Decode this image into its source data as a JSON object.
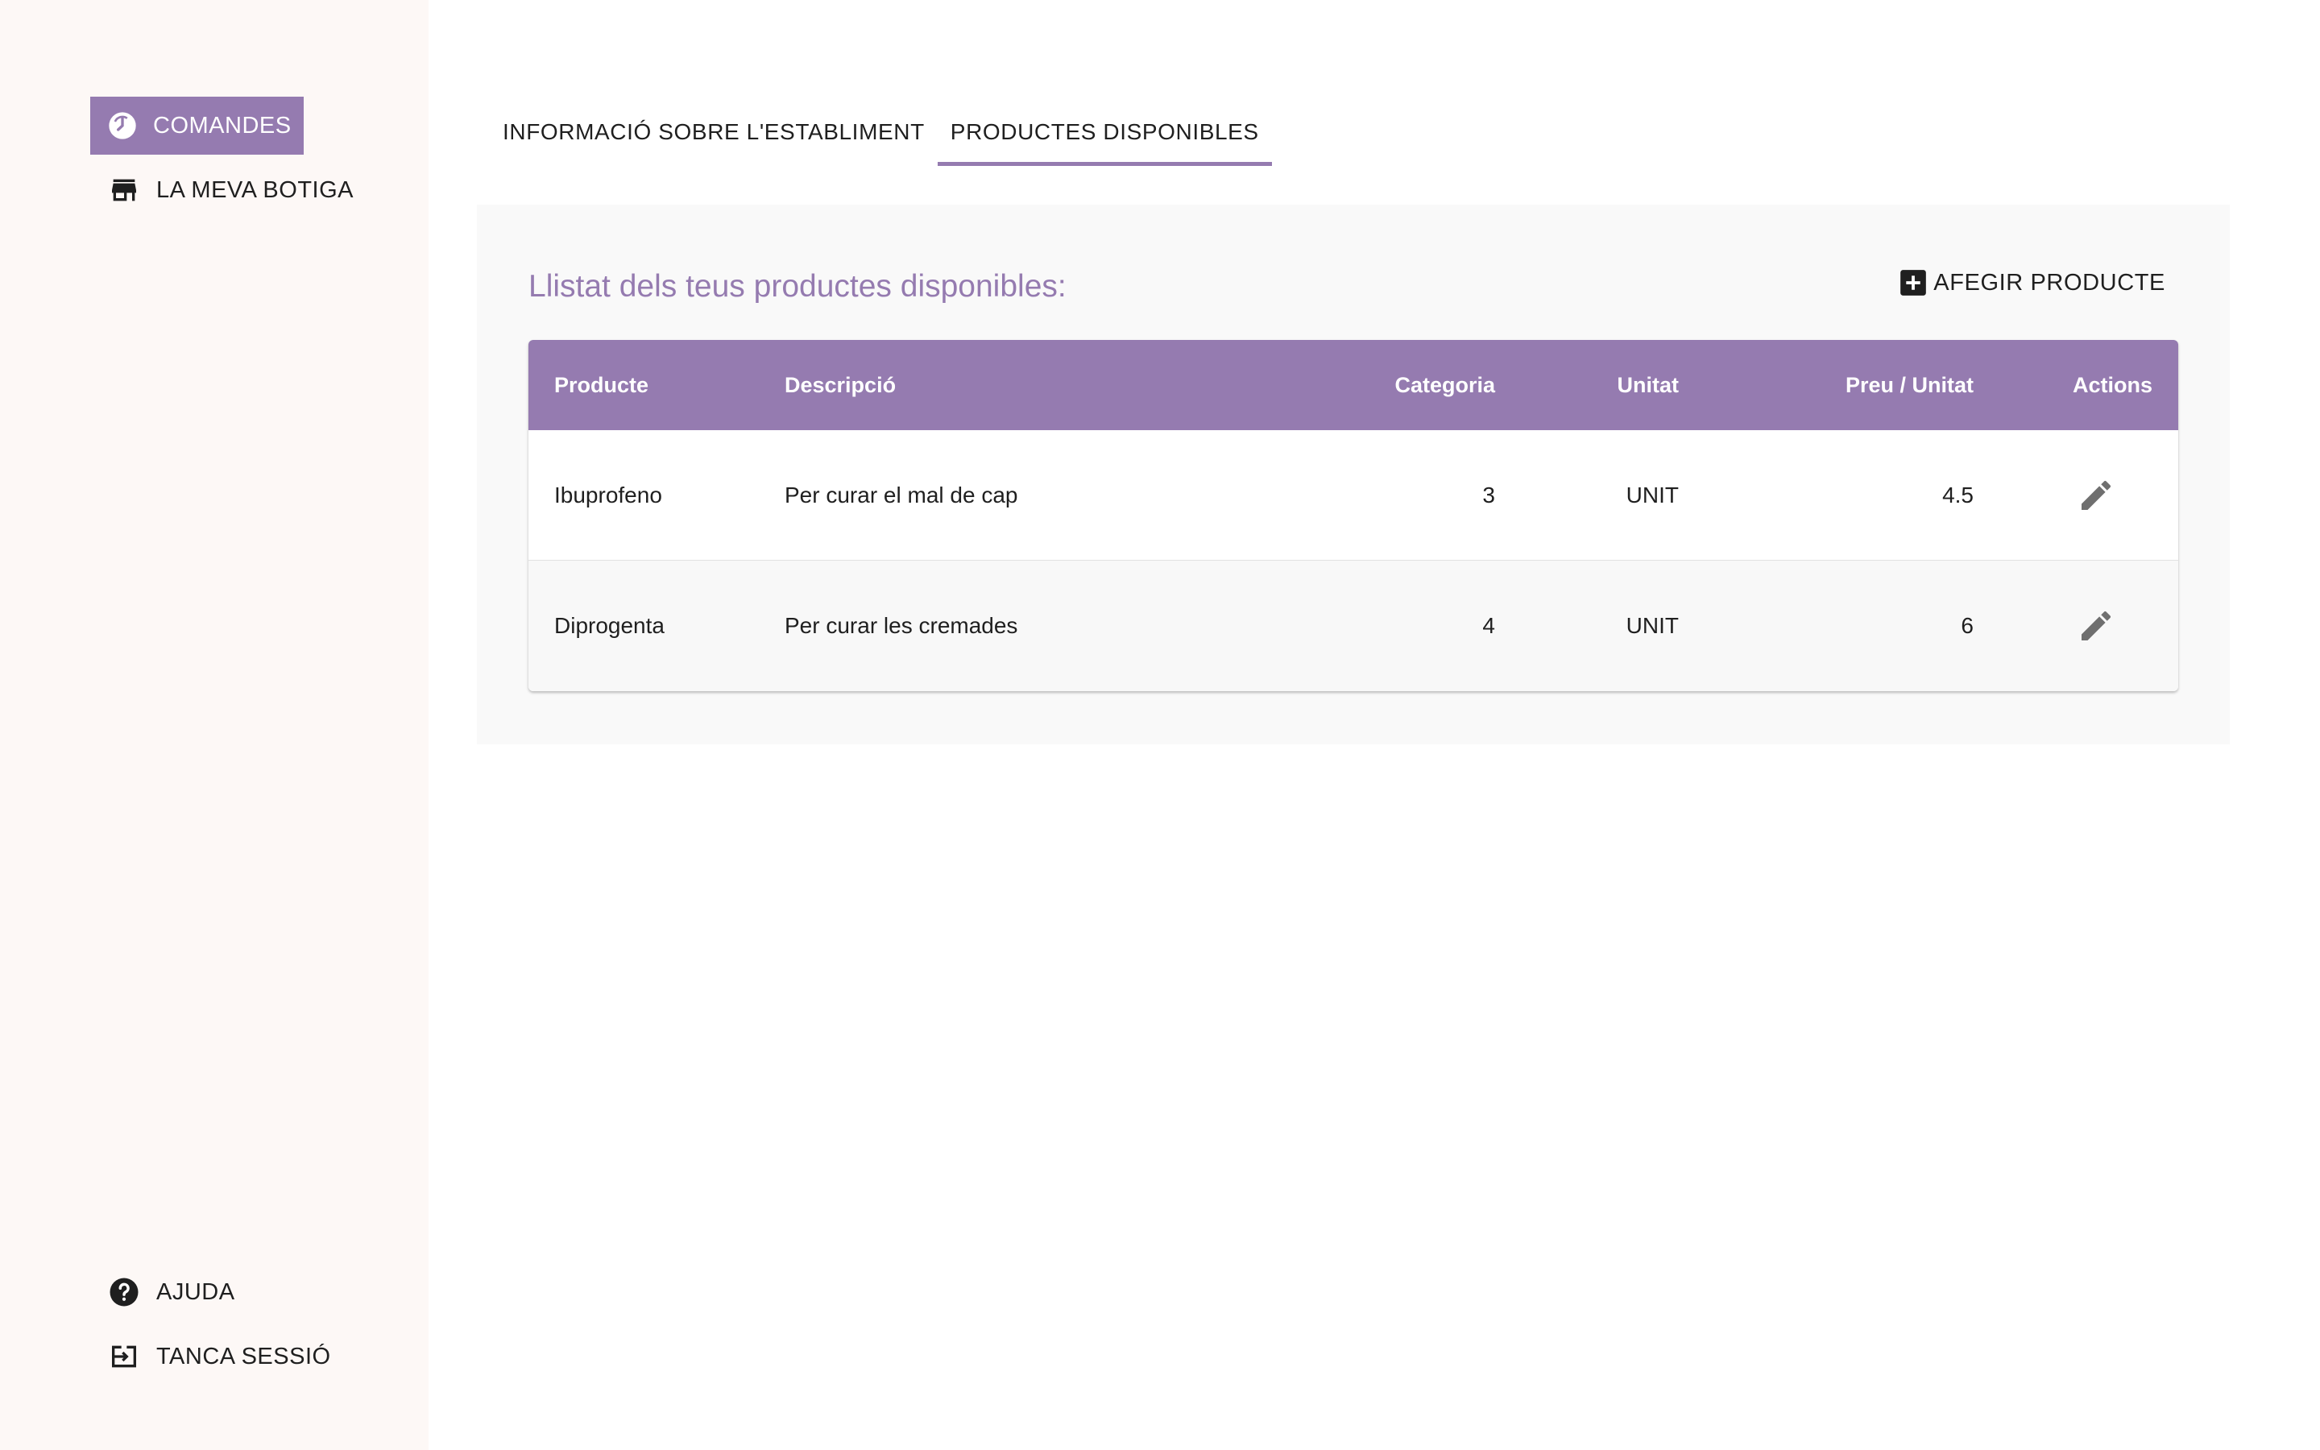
{
  "sidebar": {
    "items": [
      {
        "label": "COMANDES",
        "icon": "orders-clock-icon",
        "active": true
      },
      {
        "label": "LA MEVA BOTIGA",
        "icon": "store-icon",
        "active": false
      }
    ],
    "bottom_items": [
      {
        "label": "AJUDA",
        "icon": "help-icon"
      },
      {
        "label": "TANCA SESSIÓ",
        "icon": "logout-icon"
      }
    ]
  },
  "tabs": [
    {
      "label": "INFORMACIÓ SOBRE L'ESTABLIMENT",
      "active": false
    },
    {
      "label": "PRODUCTES DISPONIBLES",
      "active": true
    }
  ],
  "panel": {
    "title": "Llistat dels teus productes disponibles:",
    "add_button": "AFEGIR PRODUCTE"
  },
  "table": {
    "headers": [
      "Producte",
      "Descripció",
      "Categoria",
      "Unitat",
      "Preu / Unitat",
      "Actions"
    ],
    "rows": [
      [
        "Ibuprofeno",
        "Per curar el mal de cap",
        "3",
        "UNIT",
        "4.5"
      ],
      [
        "Diprogenta",
        "Per curar les cremades",
        "4",
        "UNIT",
        "6"
      ]
    ]
  },
  "colors": {
    "accent": "#957bb0",
    "sidebar_bg": "#fdf8f6",
    "panel_bg": "#f9f9f9"
  }
}
